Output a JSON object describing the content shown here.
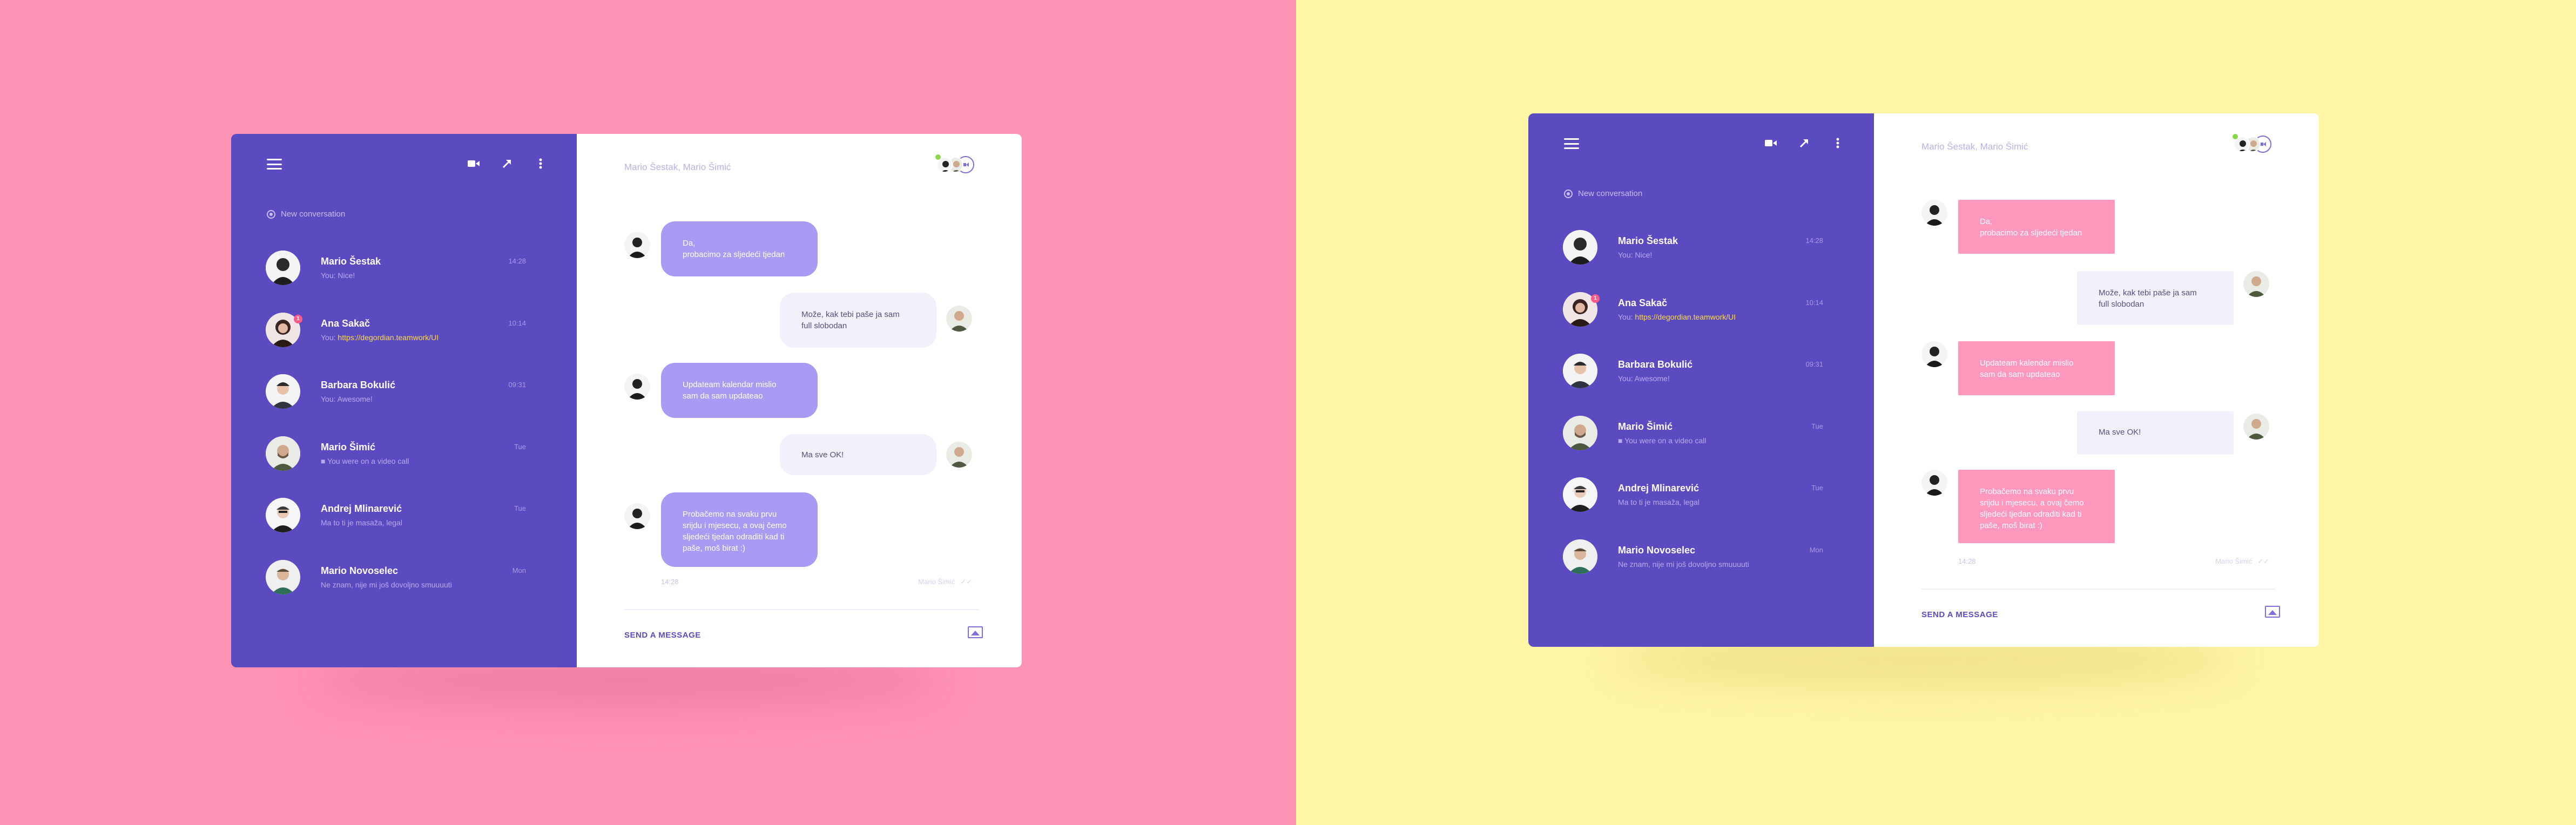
{
  "colors": {
    "left_background": "#ff93b6",
    "right_background": "#fff6a6",
    "sidebar": "#5a4bc0",
    "incoming_bubble_left": "#a79bf4",
    "incoming_bubble_right": "#ff98bc",
    "outgoing_bubble": "#f2f0fb",
    "link": "#ffd84a"
  },
  "sidebar": {
    "new_conversation": "New conversation",
    "conversations": [
      {
        "name": "Mario Šestak",
        "preview_prefix": "",
        "preview": "You: Nice!",
        "time": "14:28",
        "badge": ""
      },
      {
        "name": "Ana Sakač",
        "preview_prefix": "You:",
        "preview": "https://degordian.teamwork/UI",
        "time": "10:14",
        "badge": "1"
      },
      {
        "name": "Barbara Bokulić",
        "preview_prefix": "",
        "preview": "You: Awesome!",
        "time": "09:31",
        "badge": ""
      },
      {
        "name": "Mario Šimić",
        "preview_prefix": "",
        "preview": "You were on a video call",
        "time": "Tue",
        "badge": ""
      },
      {
        "name": "Andrej Mlinarević",
        "preview_prefix": "",
        "preview": "Ma to ti je masaža, legal",
        "time": "Tue",
        "badge": ""
      },
      {
        "name": "Mario Novoselec",
        "preview_prefix": "",
        "preview": "Ne znam, nije mi još dovoljno smuuuuti",
        "time": "Mon",
        "badge": ""
      }
    ]
  },
  "chat": {
    "title": "Mario Šestak, Mario Šimić",
    "messages": [
      {
        "direction": "in",
        "line1": "Da,",
        "line2": "probacimo za sljedeći tjedan",
        "line3": "",
        "line4": ""
      },
      {
        "direction": "out",
        "line1": "Može, kak tebi paše ja sam",
        "line2": "full slobodan",
        "line3": "",
        "line4": ""
      },
      {
        "direction": "in",
        "line1": "Updateam kalendar mislio",
        "line2": "sam da sam updateao",
        "line3": "",
        "line4": ""
      },
      {
        "direction": "out",
        "line1": "Ma sve OK!",
        "line2": "",
        "line3": "",
        "line4": ""
      },
      {
        "direction": "in",
        "line1": "Probačemo na svaku prvu",
        "line2": "srijdu i mjesecu, a ovaj čemo",
        "line3": "sljedeći tjedan odraditi kad ti",
        "line4": "paše, moš birat :)"
      }
    ],
    "last_time": "14:28",
    "seen_by": "Mario Šimić",
    "send_label": "SEND A MESSAGE"
  }
}
